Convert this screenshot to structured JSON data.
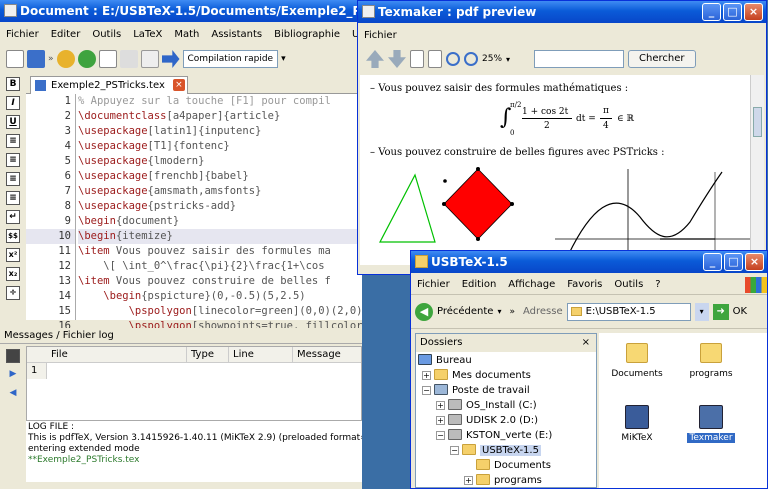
{
  "main": {
    "title": "Document : E:/USBTeX-1.5/Documents/Exemple2_PSTricks.tex",
    "menu": [
      "Fichier",
      "Editer",
      "Outils",
      "LaTeX",
      "Math",
      "Assistants",
      "Bibliographie",
      "Utilisateur"
    ],
    "toolbar": {
      "quick_build": "Compilation rapide"
    },
    "left_toolbar": [
      "B",
      "I",
      "U",
      "",
      "",
      "",
      "",
      "",
      "$$",
      "x²",
      "x₂",
      "÷"
    ],
    "tab": {
      "label": "Exemple2_PSTricks.tex"
    },
    "editor": {
      "line_numbers": [
        "1",
        "2",
        "3",
        "4",
        "5",
        "6",
        "7",
        "8",
        "9",
        "10",
        "11",
        "12",
        "13",
        "14",
        "15",
        "16"
      ],
      "highlight_line": 9,
      "lines": [
        {
          "parts": [
            {
              "c": "cmt",
              "t": "% Appuyez sur la touche [F1] pour compil"
            }
          ]
        },
        {
          "parts": [
            {
              "c": "kw",
              "t": "\\documentclass"
            },
            {
              "c": "br",
              "t": "[a4paper]{article}"
            }
          ]
        },
        {
          "parts": [
            {
              "c": "kw",
              "t": "\\usepackage"
            },
            {
              "c": "br",
              "t": "[latin1]{inputenc}"
            }
          ]
        },
        {
          "parts": [
            {
              "c": "kw",
              "t": "\\usepackage"
            },
            {
              "c": "br",
              "t": "[T1]{fontenc}"
            }
          ]
        },
        {
          "parts": [
            {
              "c": "kw",
              "t": "\\usepackage"
            },
            {
              "c": "br",
              "t": "{lmodern}"
            }
          ]
        },
        {
          "parts": [
            {
              "c": "kw",
              "t": "\\usepackage"
            },
            {
              "c": "br",
              "t": "[frenchb]{babel}"
            }
          ]
        },
        {
          "parts": [
            {
              "c": "kw",
              "t": "\\usepackage"
            },
            {
              "c": "br",
              "t": "{amsmath,amsfonts}"
            }
          ]
        },
        {
          "parts": [
            {
              "c": "kw",
              "t": "\\usepackage"
            },
            {
              "c": "br",
              "t": "{pstricks-add}"
            }
          ]
        },
        {
          "parts": [
            {
              "c": "kw",
              "t": "\\begin"
            },
            {
              "c": "br",
              "t": "{document}"
            }
          ]
        },
        {
          "parts": [
            {
              "c": "kw",
              "t": "\\begin"
            },
            {
              "c": "br",
              "t": "{itemize}"
            }
          ]
        },
        {
          "parts": [
            {
              "c": "kw",
              "t": "\\item"
            },
            {
              "c": "br",
              "t": " Vous pouvez saisir des formules ma"
            }
          ]
        },
        {
          "parts": [
            {
              "c": "br",
              "t": "    \\[ \\int_0^\\frac{\\pi}{2}\\frac{1+\\cos"
            }
          ]
        },
        {
          "parts": [
            {
              "c": "kw",
              "t": "\\item"
            },
            {
              "c": "br",
              "t": " Vous pouvez construire de belles f"
            }
          ]
        },
        {
          "parts": [
            {
              "c": "br",
              "t": "    "
            },
            {
              "c": "kw",
              "t": "\\begin"
            },
            {
              "c": "br",
              "t": "{pspicture}(0,-0.5)(5,2.5)"
            }
          ]
        },
        {
          "parts": [
            {
              "c": "br",
              "t": "        "
            },
            {
              "c": "kw",
              "t": "\\pspolygon"
            },
            {
              "c": "br",
              "t": "[linecolor=green](0,0)(2,0)(1."
            }
          ]
        },
        {
          "parts": [
            {
              "c": "br",
              "t": "        "
            },
            {
              "c": "kw",
              "t": "\\pspolygon"
            },
            {
              "c": "br",
              "t": "[showpoints=true, fillcolor=re"
            }
          ]
        }
      ]
    },
    "messages": {
      "header": "Messages / Fichier log",
      "columns": [
        "File",
        "Type",
        "Line",
        "Message"
      ],
      "row_number": "1",
      "log_lines": [
        "LOG FILE :",
        "This is pdfTeX, Version 3.1415926-1.40.11 (MiKTeX 2.9) (preloaded format=latex 2010.11.1",
        "entering extended mode",
        "**Exemple2_PSTricks.tex"
      ]
    }
  },
  "pdf": {
    "title": "Texmaker : pdf preview",
    "menu": [
      "Fichier"
    ],
    "zoom": "25%",
    "search_button": "Chercher",
    "bullet1": "Vous pouvez saisir des formules mathématiques :",
    "formula": {
      "int_upper": "π/2",
      "int_lower": "0",
      "num": "1 + cos 2t",
      "den": "2",
      "dt": "dt =",
      "rhs_num": "π",
      "rhs_den": "4",
      "rhs_tail": "∈ ℝ"
    },
    "bullet2": "Vous pouvez construire de belles figures avec PSTricks :"
  },
  "explorer": {
    "title": "USBTeX-1.5",
    "menu": [
      "Fichier",
      "Edition",
      "Affichage",
      "Favoris",
      "Outils",
      "?"
    ],
    "back_label": "Précédente",
    "address_label": "Adresse",
    "address_value": "E:\\USBTeX-1.5",
    "ok_label": "OK",
    "tree_header": "Dossiers",
    "tree": [
      "Bureau",
      "Mes documents",
      "Poste de travail",
      "OS_Install (C:)",
      "UDISK 2.0 (D:)",
      "KSTON_verte (E:)",
      "USBTeX-1.5",
      "Documents",
      "programs"
    ],
    "files": [
      "Documents",
      "programs",
      "MiKTeX",
      "Texmaker"
    ]
  },
  "colors": {
    "titlebar": "#0a5bd8",
    "keyword": "#9b1a1a",
    "triangle": "#00c000",
    "diamond": "#ff0000"
  }
}
